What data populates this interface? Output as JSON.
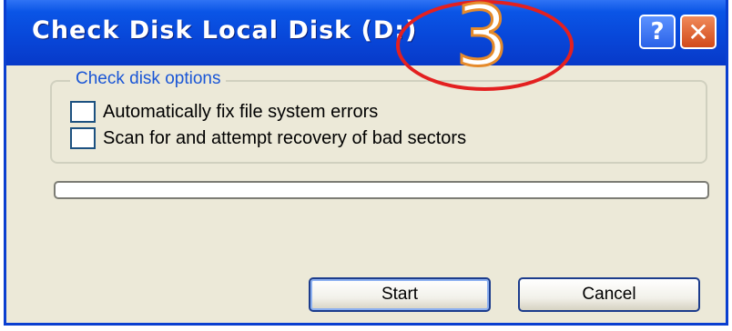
{
  "window": {
    "title": "Check Disk Local Disk (D:)",
    "help_glyph": "?",
    "close_glyph": "✕"
  },
  "annotation": {
    "number": "3",
    "circle_color": "#e32020"
  },
  "options": {
    "group_label": "Check disk options",
    "items": [
      {
        "label": "Automatically fix file system errors",
        "checked": false
      },
      {
        "label": "Scan for and attempt recovery of bad sectors",
        "checked": false
      }
    ]
  },
  "progress": {
    "value": 0
  },
  "buttons": {
    "start": "Start",
    "cancel": "Cancel"
  },
  "colors": {
    "titlebar": "#0846d8",
    "dialog_bg": "#ece9d8",
    "group_label": "#1a56d6"
  }
}
